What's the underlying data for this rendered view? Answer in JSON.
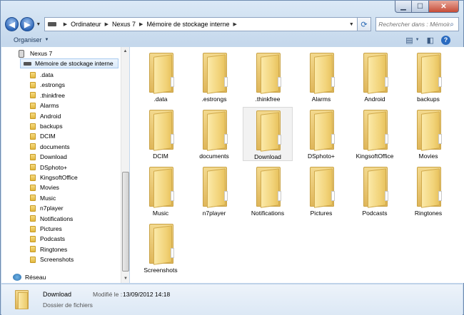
{
  "breadcrumb": [
    "Ordinateur",
    "Nexus 7",
    "Mémoire de stockage interne"
  ],
  "search": {
    "placeholder": "Rechercher dans : Mémoire..."
  },
  "toolbar": {
    "organize_label": "Organiser"
  },
  "sidebar": {
    "device": "Nexus 7",
    "storage": "Mémoire de stockage interne",
    "folders": [
      ".data",
      ".estrongs",
      ".thinkfree",
      "Alarms",
      "Android",
      "backups",
      "DCIM",
      "documents",
      "Download",
      "DSphoto+",
      "KingsoftOffice",
      "Movies",
      "Music",
      "n7player",
      "Notifications",
      "Pictures",
      "Podcasts",
      "Ringtones",
      "Screenshots"
    ],
    "network": "Réseau"
  },
  "main": {
    "selected": "Download",
    "folders": [
      ".data",
      ".estrongs",
      ".thinkfree",
      "Alarms",
      "Android",
      "backups",
      "DCIM",
      "documents",
      "Download",
      "DSphoto+",
      "KingsoftOffice",
      "Movies",
      "Music",
      "n7player",
      "Notifications",
      "Pictures",
      "Podcasts",
      "Ringtones",
      "Screenshots"
    ]
  },
  "details": {
    "name": "Download",
    "type": "Dossier de fichiers",
    "modified_label": "Modifié le :",
    "modified_value": "13/09/2012 14:18"
  },
  "icons": {
    "back": "back-arrow-icon",
    "forward": "forward-arrow-icon",
    "refresh": "refresh-icon",
    "search": "search-icon",
    "view": "view-options-icon",
    "preview": "preview-pane-icon",
    "help": "help-icon",
    "folder": "folder-icon"
  },
  "colors": {
    "accent": "#2d66b7",
    "selection_border": "#a9cbef",
    "folder": "#f1d277"
  }
}
